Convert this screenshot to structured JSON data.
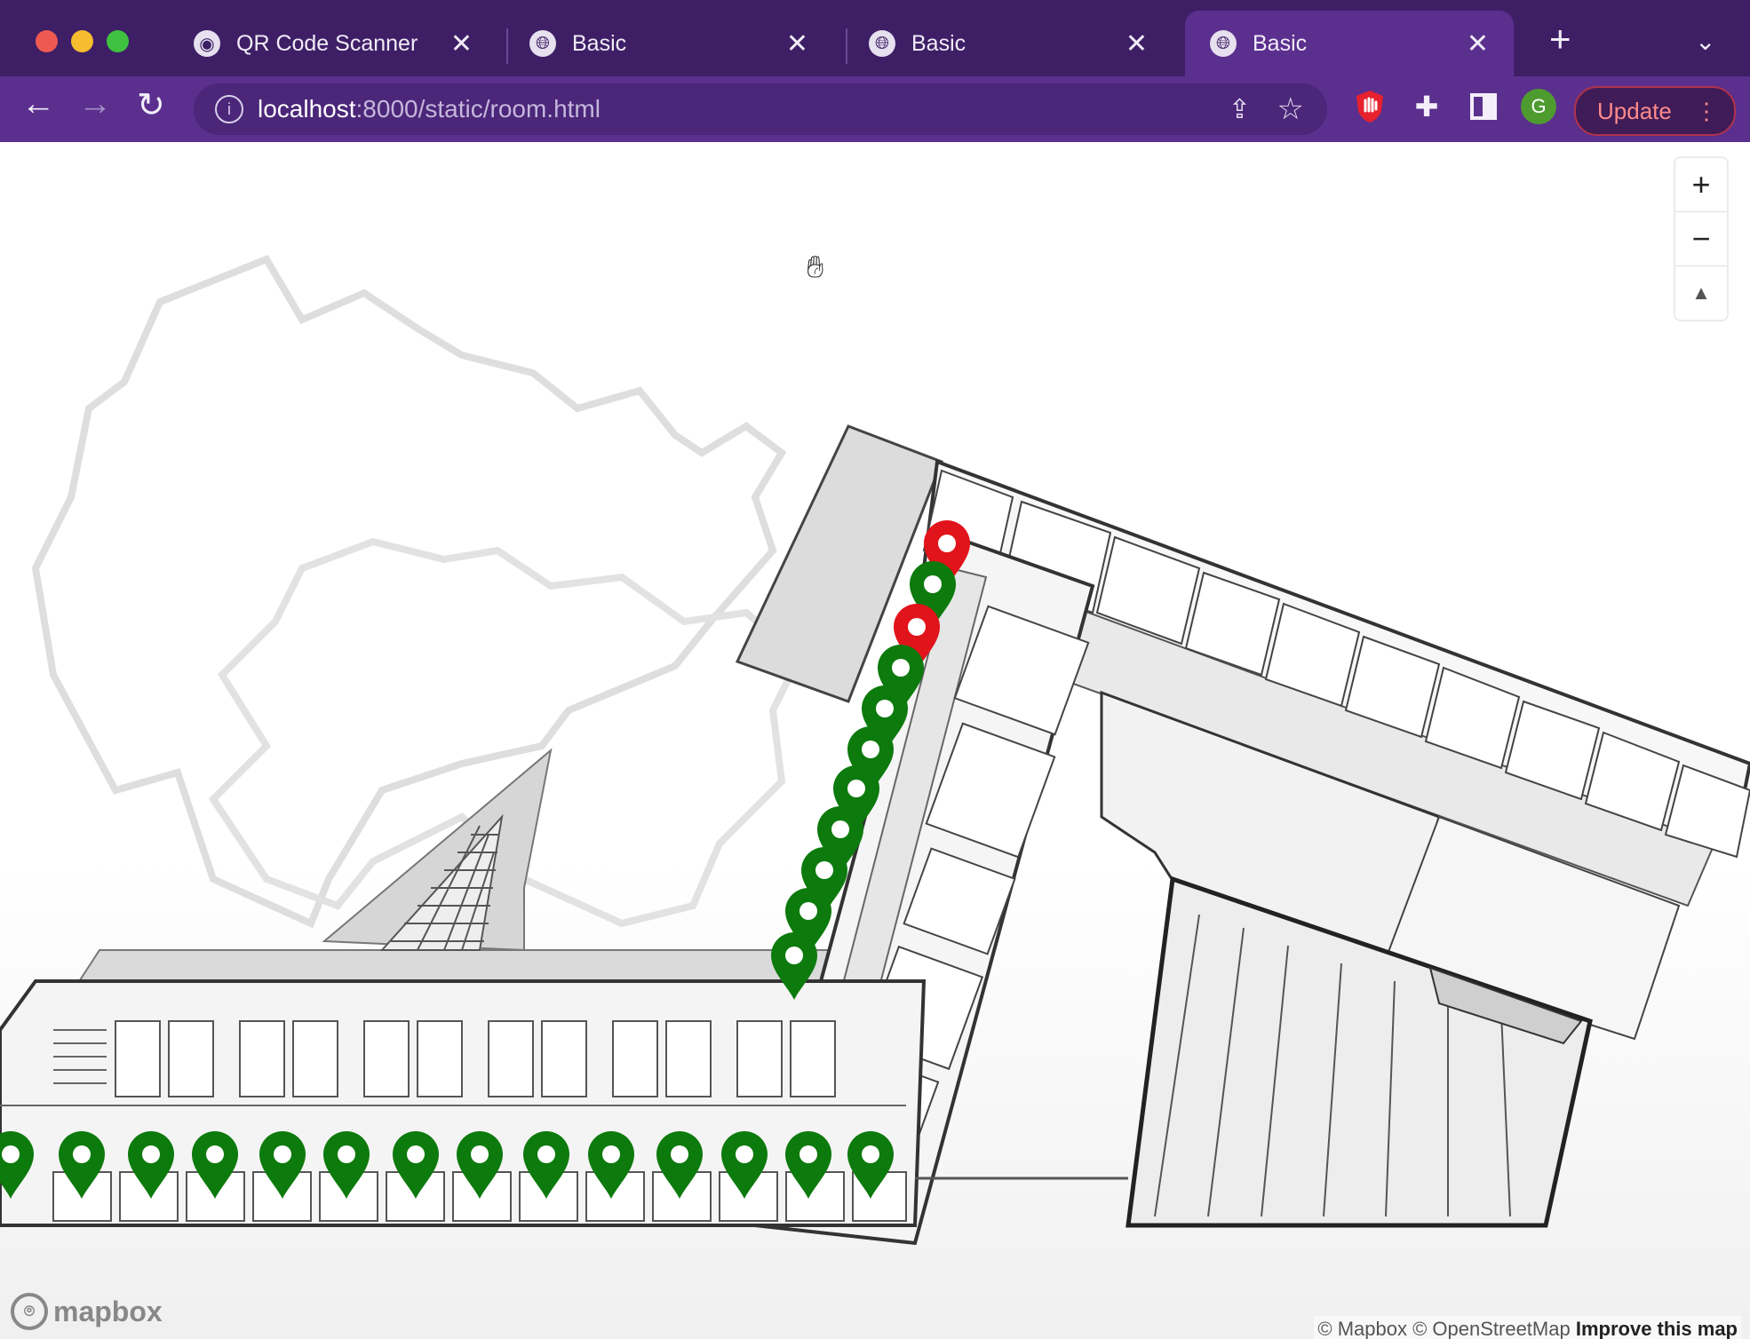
{
  "window": {
    "tabs": [
      {
        "label": "QR Code Scanner",
        "active": false
      },
      {
        "label": "Basic",
        "active": false
      },
      {
        "label": "Basic",
        "active": false
      },
      {
        "label": "Basic",
        "active": true
      }
    ],
    "address": {
      "host": "localhost",
      "rest": ":8000/static/room.html"
    },
    "profile_initial": "G",
    "update_label": "Update"
  },
  "map": {
    "zoom_in_label": "+",
    "zoom_out_label": "−",
    "compass_label": "▲",
    "logo_text": "mapbox",
    "attribution": "© Mapbox © OpenStreetMap",
    "improve_link": "Improve this map",
    "marker_colors": {
      "available": "#0d7a0d",
      "occupied": "#e1131b"
    },
    "markers": [
      {
        "status": "occupied"
      },
      {
        "status": "available"
      },
      {
        "status": "occupied"
      },
      {
        "status": "available"
      },
      {
        "status": "available"
      },
      {
        "status": "available"
      },
      {
        "status": "available"
      },
      {
        "status": "available"
      },
      {
        "status": "available"
      },
      {
        "status": "available"
      },
      {
        "status": "available"
      },
      {
        "status": "available"
      },
      {
        "status": "available"
      },
      {
        "status": "available"
      },
      {
        "status": "available"
      },
      {
        "status": "available"
      },
      {
        "status": "available"
      },
      {
        "status": "available"
      },
      {
        "status": "available"
      },
      {
        "status": "available"
      },
      {
        "status": "available"
      },
      {
        "status": "available"
      },
      {
        "status": "available"
      },
      {
        "status": "available"
      },
      {
        "status": "available"
      },
      {
        "status": "available"
      },
      {
        "status": "available"
      }
    ]
  },
  "colors": {
    "tabbar": "#3e1f66",
    "toolbar": "#5b2f8e"
  }
}
